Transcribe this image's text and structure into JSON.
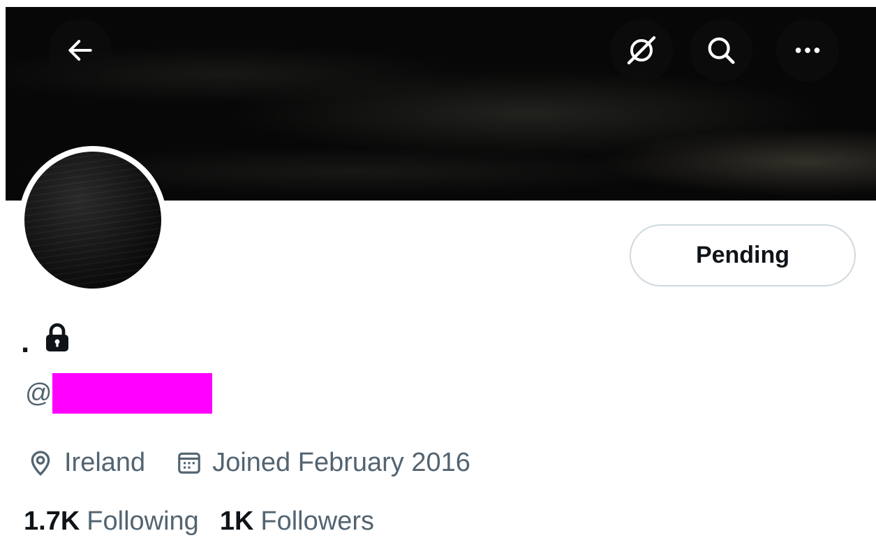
{
  "profile": {
    "display_name": ".",
    "handle_prefix": "@",
    "follow_state": "Pending",
    "location": "Ireland",
    "joined": "Joined February 2016",
    "following_count": "1.7K",
    "following_label": "Following",
    "followers_count": "1K",
    "followers_label": "Followers"
  },
  "icons": {
    "back": "arrow-left-icon",
    "grok": "grok-icon",
    "search": "search-icon",
    "more": "more-icon",
    "lock": "lock-icon",
    "location": "location-pin-icon",
    "calendar": "calendar-icon"
  },
  "colors": {
    "text_primary": "#0f1419",
    "text_secondary": "#536471",
    "redaction": "#ff00ff",
    "button_border": "#cfd9de"
  }
}
